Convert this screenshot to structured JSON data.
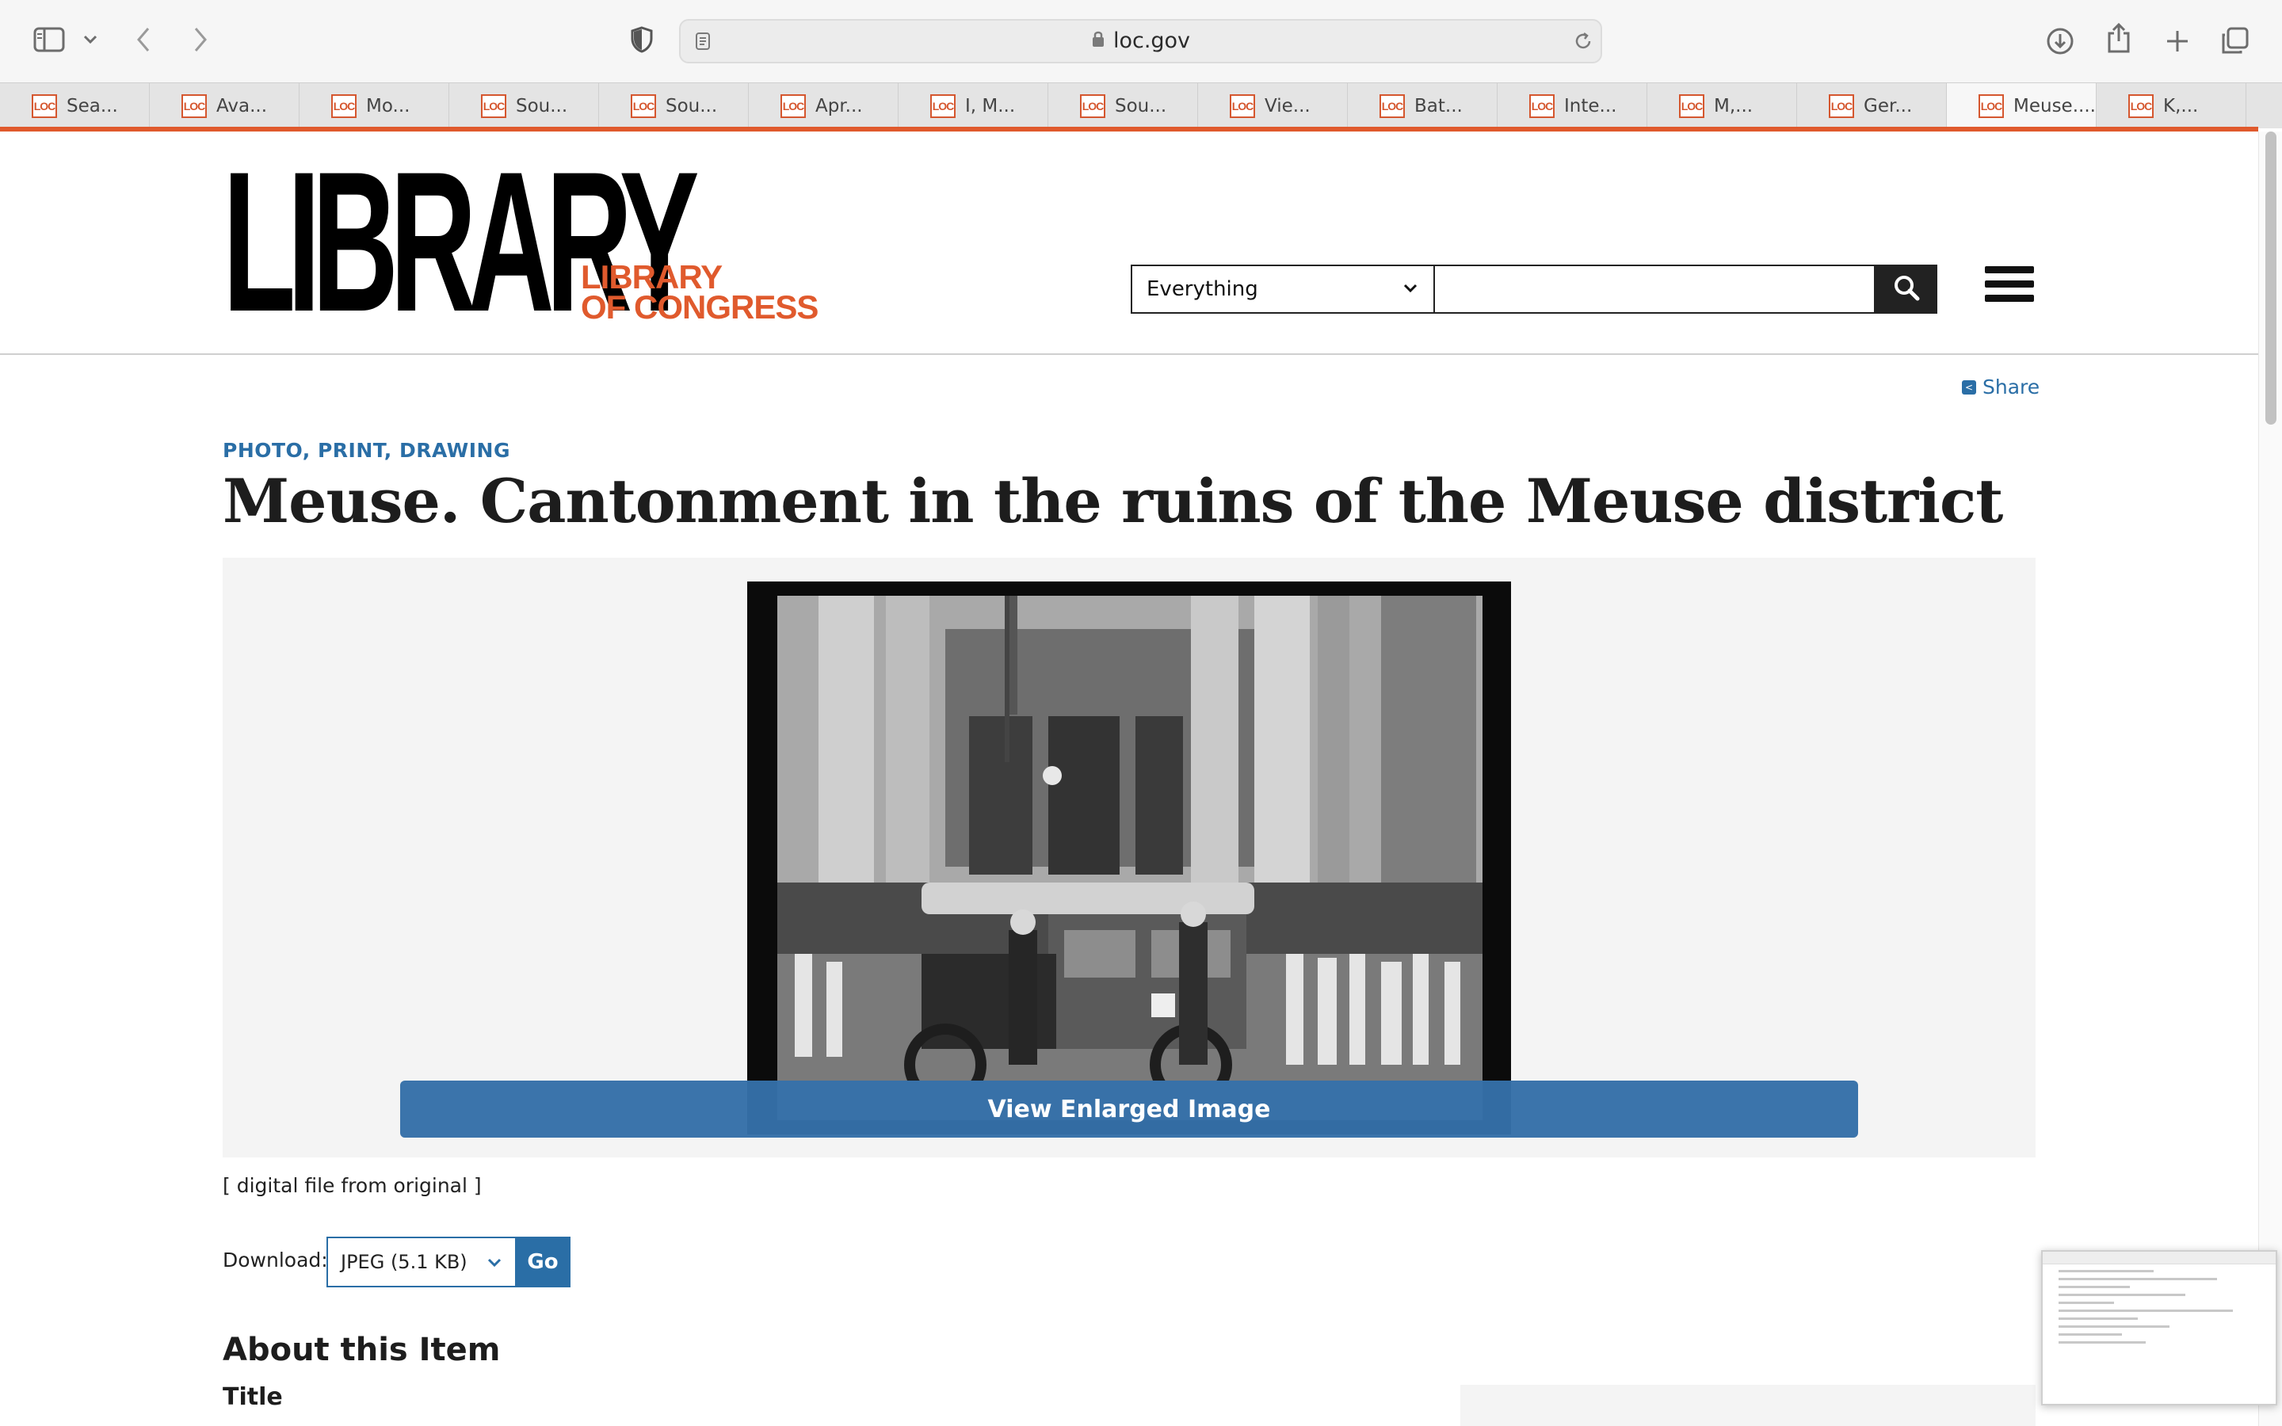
{
  "browser": {
    "url": "loc.gov",
    "tabs": [
      {
        "favicon": "LOC",
        "label": "Sea..."
      },
      {
        "favicon": "LOC",
        "label": "Ava..."
      },
      {
        "favicon": "LOC",
        "label": "Mo..."
      },
      {
        "favicon": "LOC",
        "label": "Sou..."
      },
      {
        "favicon": "LOC",
        "label": "Sou..."
      },
      {
        "favicon": "LOC",
        "label": "Apr..."
      },
      {
        "favicon": "LOC",
        "label": "I, M..."
      },
      {
        "favicon": "LOC",
        "label": "Sou..."
      },
      {
        "favicon": "LOC",
        "label": "Vie..."
      },
      {
        "favicon": "LOC",
        "label": "Bat..."
      },
      {
        "favicon": "LOC",
        "label": "Inte..."
      },
      {
        "favicon": "LOC",
        "label": "M,..."
      },
      {
        "favicon": "LOC",
        "label": "Ger..."
      },
      {
        "favicon": "LOC",
        "label": "Meuse...."
      },
      {
        "favicon": "LOC",
        "label": "K,..."
      }
    ],
    "active_tab_index": 13,
    "accent_color": "#e05a2d"
  },
  "header": {
    "logo_main": "LIBRARY",
    "logo_sub_line1": "LIBRARY",
    "logo_sub_line2": "OF CONGRESS",
    "search_scope": "Everything",
    "search_value": ""
  },
  "item": {
    "share_label": "Share",
    "format": "PHOTO, PRINT, DRAWING",
    "title": "Meuse. Cantonment in the ruins of the Meuse district",
    "view_enlarged": "View Enlarged Image",
    "caption": "[ digital file from original ]",
    "download_label": "Download:",
    "download_option": "JPEG (5.1 KB)",
    "download_go": "Go",
    "about_heading": "About this Item",
    "title_label": "Title"
  },
  "icons": {
    "sidebar": "sidebar-icon",
    "back": "chevron-left-icon",
    "forward": "chevron-right-icon",
    "privacy": "shield-icon",
    "reader": "reader-icon",
    "lock": "lock-icon",
    "reload": "reload-icon",
    "download": "download-icon",
    "share": "share-icon",
    "new_tab": "plus-icon",
    "tab_overview": "tabs-icon",
    "search": "search-icon",
    "menu": "hamburger-icon"
  }
}
